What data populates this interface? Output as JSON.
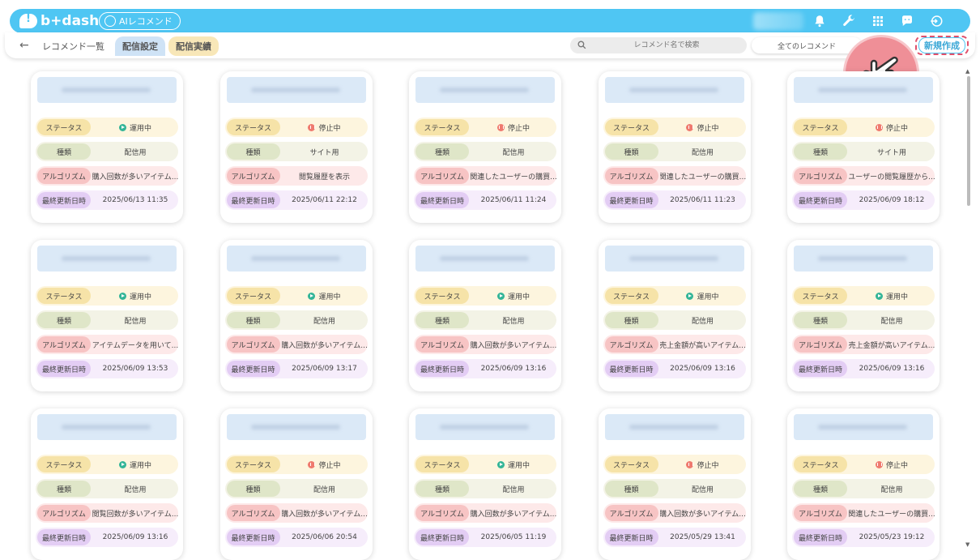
{
  "header": {
    "logo_text": "b+dash",
    "module_label": "AIレコメンド",
    "icons": [
      "bell-icon",
      "wrench-icon",
      "grid-icon",
      "chat-icon",
      "logout-icon"
    ]
  },
  "subbar": {
    "back_symbol": "←",
    "breadcrumb": "レコメンド一覧",
    "tabs": [
      {
        "label": "配信設定",
        "active": true
      },
      {
        "label": "配信実績",
        "active": false
      }
    ],
    "search_placeholder": "レコメンド名で検索",
    "filter_label": "全てのレコメンド",
    "new_button_label": "新規作成"
  },
  "labels": {
    "status": "ステータス",
    "type": "種類",
    "algorithm": "アルゴリズム",
    "updated": "最終更新日時"
  },
  "cards": [
    {
      "status": "運用中",
      "status_kind": "run",
      "type": "配信用",
      "algorithm": "購入回数が多いアイテム...",
      "updated": "2025/06/13 11:35"
    },
    {
      "status": "停止中",
      "status_kind": "stop",
      "type": "サイト用",
      "algorithm": "閲覧履歴を表示",
      "updated": "2025/06/11 22:12"
    },
    {
      "status": "停止中",
      "status_kind": "stop",
      "type": "配信用",
      "algorithm": "関連したユーザーの購買...",
      "updated": "2025/06/11 11:24"
    },
    {
      "status": "停止中",
      "status_kind": "stop",
      "type": "配信用",
      "algorithm": "関連したユーザーの購買...",
      "updated": "2025/06/11 11:23"
    },
    {
      "status": "停止中",
      "status_kind": "stop",
      "type": "サイト用",
      "algorithm": "ユーザーの閲覧履歴から...",
      "updated": "2025/06/09 18:12"
    },
    {
      "status": "運用中",
      "status_kind": "run",
      "type": "配信用",
      "algorithm": "アイテムデータを用いて...",
      "updated": "2025/06/09 13:53"
    },
    {
      "status": "運用中",
      "status_kind": "run",
      "type": "配信用",
      "algorithm": "購入回数が多いアイテム...",
      "updated": "2025/06/09 13:17"
    },
    {
      "status": "運用中",
      "status_kind": "run",
      "type": "配信用",
      "algorithm": "購入回数が多いアイテム...",
      "updated": "2025/06/09 13:16"
    },
    {
      "status": "運用中",
      "status_kind": "run",
      "type": "配信用",
      "algorithm": "売上金額が高いアイテム...",
      "updated": "2025/06/09 13:16"
    },
    {
      "status": "運用中",
      "status_kind": "run",
      "type": "配信用",
      "algorithm": "売上金額が高いアイテム...",
      "updated": "2025/06/09 13:16"
    },
    {
      "status": "運用中",
      "status_kind": "run",
      "type": "配信用",
      "algorithm": "閲覧回数が多いアイテム...",
      "updated": "2025/06/09 13:16"
    },
    {
      "status": "停止中",
      "status_kind": "stop",
      "type": "配信用",
      "algorithm": "購入回数が多いアイテム...",
      "updated": "2025/06/06 20:54"
    },
    {
      "status": "運用中",
      "status_kind": "run",
      "type": "配信用",
      "algorithm": "購入回数が多いアイテム...",
      "updated": "2025/06/05 11:19"
    },
    {
      "status": "停止中",
      "status_kind": "stop",
      "type": "配信用",
      "algorithm": "購入回数が多いアイテム...",
      "updated": "2025/05/29 13:41"
    },
    {
      "status": "停止中",
      "status_kind": "stop",
      "type": "配信用",
      "algorithm": "関連したユーザーの購買...",
      "updated": "2025/05/23 19:12"
    }
  ]
}
